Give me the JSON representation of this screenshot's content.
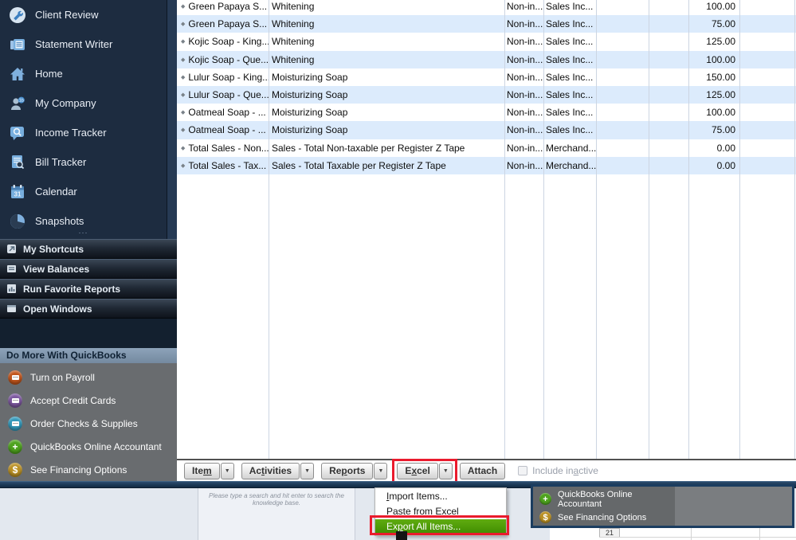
{
  "sidebar": {
    "nav": [
      {
        "label": "Client Review"
      },
      {
        "label": "Statement Writer"
      },
      {
        "label": "Home"
      },
      {
        "label": "My Company"
      },
      {
        "label": "Income Tracker"
      },
      {
        "label": "Bill Tracker"
      },
      {
        "label": "Calendar"
      },
      {
        "label": "Snapshots"
      }
    ],
    "sections": [
      {
        "label": "My Shortcuts"
      },
      {
        "label": "View Balances"
      },
      {
        "label": "Run Favorite Reports"
      },
      {
        "label": "Open Windows"
      }
    ],
    "do_more": {
      "header": "Do More With QuickBooks",
      "items": [
        {
          "label": "Turn on Payroll",
          "color": "#c2561d"
        },
        {
          "label": "Accept Credit Cards",
          "color": "#7d58a0"
        },
        {
          "label": "Order Checks & Supplies",
          "color": "#3399bb"
        },
        {
          "label": "QuickBooks Online Accountant",
          "color": "#4ea31e",
          "glyph": "+"
        },
        {
          "label": "See Financing Options",
          "color": "#bb9125",
          "glyph": "$"
        }
      ]
    }
  },
  "table": {
    "rows": [
      {
        "name": "Green Papaya S...",
        "description": "Whitening",
        "type": "Non-in...",
        "account": "Sales Inc...",
        "price": "100.00"
      },
      {
        "name": "Green Papaya S...",
        "description": "Whitening",
        "type": "Non-in...",
        "account": "Sales Inc...",
        "price": "75.00"
      },
      {
        "name": "Kojic Soap - King...",
        "description": "Whitening",
        "type": "Non-in...",
        "account": "Sales Inc...",
        "price": "125.00"
      },
      {
        "name": "Kojic Soap - Que...",
        "description": "Whitening",
        "type": "Non-in...",
        "account": "Sales Inc...",
        "price": "100.00"
      },
      {
        "name": "Lulur Soap - King...",
        "description": "Moisturizing Soap",
        "type": "Non-in...",
        "account": "Sales Inc...",
        "price": "150.00"
      },
      {
        "name": "Lulur Soap - Que...",
        "description": "Moisturizing Soap",
        "type": "Non-in...",
        "account": "Sales Inc...",
        "price": "125.00"
      },
      {
        "name": "Oatmeal Soap - ...",
        "description": "Moisturizing Soap",
        "type": "Non-in...",
        "account": "Sales Inc...",
        "price": "100.00"
      },
      {
        "name": "Oatmeal Soap - ...",
        "description": "Moisturizing Soap",
        "type": "Non-in...",
        "account": "Sales Inc...",
        "price": "75.00"
      },
      {
        "name": "Total Sales - Non...",
        "description": "Sales - Total Non-taxable per Register Z Tape",
        "type": "Non-in...",
        "account": "Merchand...",
        "price": "0.00"
      },
      {
        "name": "Total Sales - Tax...",
        "description": "Sales - Total Taxable per Register Z Tape",
        "type": "Non-in...",
        "account": "Merchand...",
        "price": "0.00"
      }
    ]
  },
  "toolbar": {
    "item": {
      "pre": "Ite",
      "accel": "m",
      "post": ""
    },
    "activities": {
      "pre": "Ac",
      "accel": "t",
      "post": "ivities"
    },
    "reports": {
      "pre": "Re",
      "accel": "p",
      "post": "orts"
    },
    "excel": {
      "pre": "E",
      "accel": "x",
      "post": "cel"
    },
    "attach": "Attach",
    "dropdown_glyph": "▼",
    "include_inactive": {
      "pre": "Include in",
      "accel": "a",
      "post": "ctive"
    }
  },
  "excel_menu": {
    "items": [
      {
        "pre": "",
        "accel": "I",
        "post": "mport Items..."
      },
      {
        "pre": "",
        "accel": "",
        "post": "Paste from Excel"
      },
      {
        "pre": "Ex",
        "accel": "p",
        "post": "ort All Items..."
      }
    ]
  },
  "knowledge_base": {
    "placeholder": "Please type a search and hit enter to search the knowledge base."
  },
  "promo_panel": {
    "items": [
      {
        "label": "QuickBooks Online Accountant",
        "color": "#4ea31e",
        "glyph": "+"
      },
      {
        "label": "See Financing Options",
        "color": "#bb9125",
        "glyph": "$"
      }
    ]
  },
  "sheet": {
    "row_number": "21"
  },
  "misc": {
    "splitter_glyph": "···",
    "diamond_glyph": "◆"
  },
  "colors": {
    "annotation_red": "#ea1b2d",
    "menu_highlight_green": "#4f9c08",
    "row_stripe_blue": "#dcebfc",
    "sidebar_navy": "#1d2c40",
    "band_navy": "#1b3855",
    "domore_header_bg": "#8096ad",
    "domore_section_gray": "#696c6f"
  }
}
